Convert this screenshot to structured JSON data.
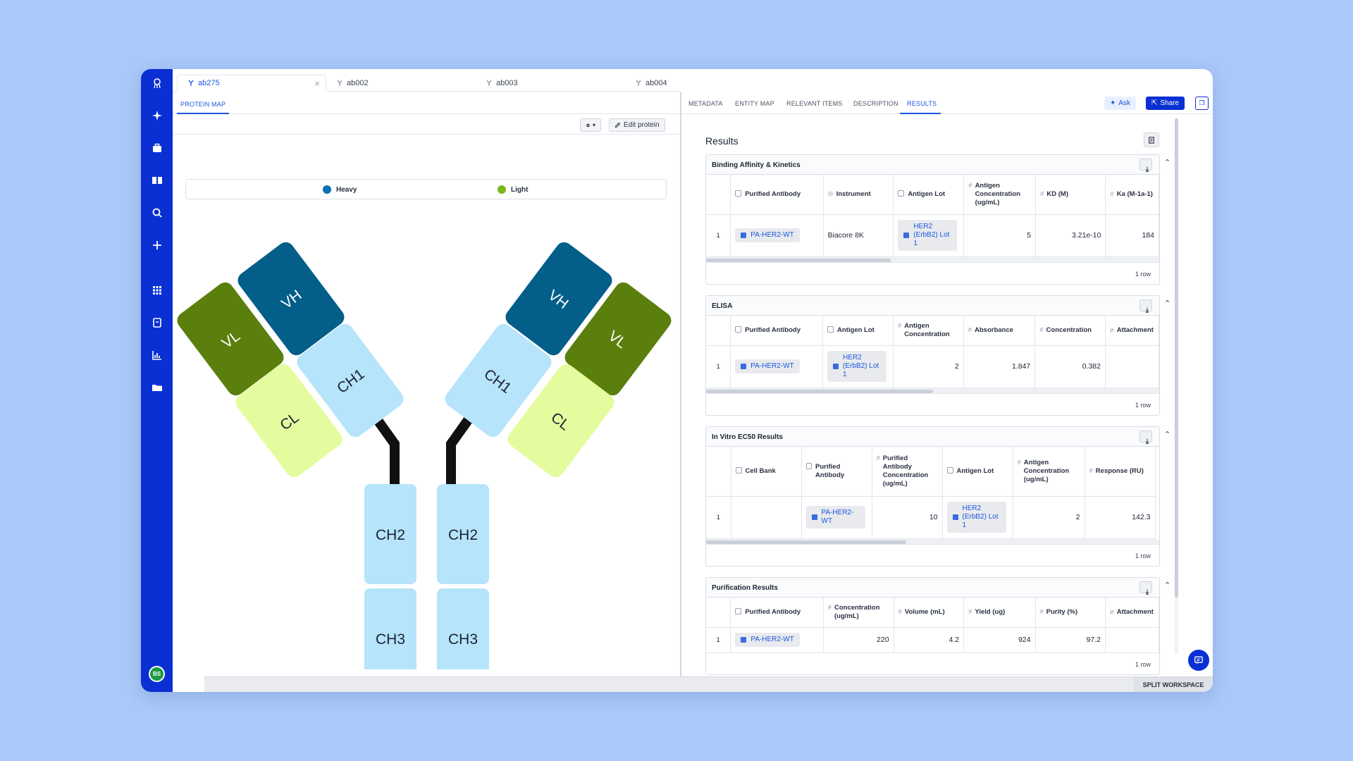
{
  "tabs": [
    {
      "label": "ab275"
    },
    {
      "label": "ab002"
    },
    {
      "label": "ab003"
    },
    {
      "label": "ab004"
    }
  ],
  "left_panel": {
    "subtab": "PROTEIN MAP",
    "edit_label": "Edit protein",
    "legend": {
      "heavy": "Heavy",
      "light": "Light"
    },
    "domains": {
      "vh": "VH",
      "vl": "VL",
      "ch1": "CH1",
      "cl": "CL",
      "ch2": "CH2",
      "ch3": "CH3"
    }
  },
  "colors": {
    "heavy": "#00567f",
    "light": "#7cb61e",
    "vh": "#035e89",
    "vl": "#5a7f0c",
    "ch": "#b6e4fb",
    "cl": "#e4fc9e",
    "accent": "#0a2fd3"
  },
  "right_panel": {
    "tabs": [
      "METADATA",
      "ENTITY MAP",
      "RELEVANT ITEMS",
      "DESCRIPTION",
      "RESULTS"
    ],
    "ask": "Ask",
    "share": "Share",
    "title": "Results"
  },
  "cards": {
    "binding": {
      "title": "Binding Affinity & Kinetics",
      "headers": [
        "Purified Antibody",
        "Instrument",
        "Antigen Lot",
        "Antigen Concentration (ug/mL)",
        "KD (M)",
        "Ka (M-1a-1)"
      ],
      "row": {
        "idx": "1",
        "antibody": "PA-HER2-WT",
        "instrument": "Biacore 8K",
        "lot": "HER2 (ErbB2) Lot 1",
        "conc": "5",
        "kd": "3.21e-10",
        "ka": "184"
      },
      "count": "1 row"
    },
    "elisa": {
      "title": "ELISA",
      "headers": [
        "Purified Antibody",
        "Antigen Lot",
        "Antigen Concentration",
        "Absorbance",
        "Concentration",
        "Attachment"
      ],
      "row": {
        "idx": "1",
        "antibody": "PA-HER2-WT",
        "lot": "HER2 (ErbB2) Lot 1",
        "conc": "2",
        "absorbance": "1.847",
        "concentration": "0.382"
      },
      "count": "1 row"
    },
    "ec50": {
      "title": "In Vitro EC50 Results",
      "headers": [
        "Cell Bank",
        "Purified Antibody",
        "Purified Antibody Concentration (ug/mL)",
        "Antigen Lot",
        "Antigen Concentration (ug/mL)",
        "Response (RU)"
      ],
      "row": {
        "idx": "1",
        "antibody": "PA-HER2-WT",
        "ab_conc": "10",
        "lot": "HER2 (ErbB2) Lot 1",
        "ag_conc": "2",
        "response": "142.3"
      },
      "count": "1 row"
    },
    "purification": {
      "title": "Purification Results",
      "headers": [
        "Purified Antibody",
        "Concentration (ug/mL)",
        "Volume (mL)",
        "Yield (ug)",
        "Purity (%)",
        "Attachment"
      ],
      "row": {
        "idx": "1",
        "antibody": "PA-HER2-WT",
        "conc": "220",
        "volume": "4.2",
        "yield": "924",
        "purity": "97.2"
      },
      "count": "1 row"
    }
  },
  "status": {
    "split": "SPLIT WORKSPACE"
  },
  "user": {
    "initials": "BS"
  }
}
